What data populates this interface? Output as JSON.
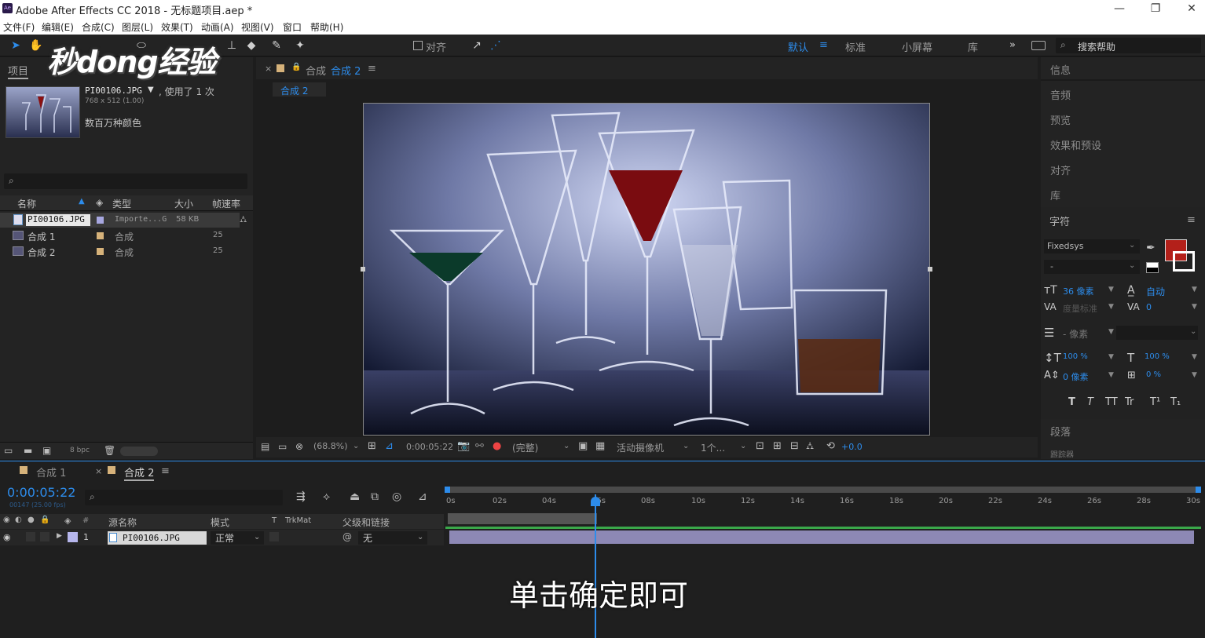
{
  "app": {
    "title": "Adobe After Effects CC 2018 - 无标题项目.aep *",
    "logo_text": "Ae"
  },
  "window_controls": {
    "minimize": "—",
    "maximize": "❐",
    "close": "✕"
  },
  "menu": [
    "文件(F)",
    "编辑(E)",
    "合成(C)",
    "图层(L)",
    "效果(T)",
    "动画(A)",
    "视图(V)",
    "窗口",
    "帮助(H)"
  ],
  "toolbar": {
    "align_label": "对齐",
    "workspaces": [
      "默认",
      "标准",
      "小屏幕",
      "库"
    ],
    "more": "»",
    "search_placeholder": "搜索帮助"
  },
  "watermark": "秒dong经验",
  "project": {
    "tab_label": "项目",
    "file_name": "PI00106.JPG",
    "usage": ", 使用了 1 次",
    "dimensions": "768 x 512 (1.00)",
    "colors": "数百万种颜色",
    "columns": [
      "名称",
      "类型",
      "大小",
      "帧速率"
    ],
    "rows": [
      {
        "name": "PI00106.JPG",
        "type": "Importe...G",
        "size": "58 KB",
        "fps": ""
      },
      {
        "name": "合成 1",
        "type": "合成",
        "size": "",
        "fps": "25"
      },
      {
        "name": "合成 2",
        "type": "合成",
        "size": "",
        "fps": "25"
      }
    ],
    "bpc": "8 bpc"
  },
  "comp": {
    "close": "×",
    "lock": "🔒",
    "title": "合成",
    "name": "合成 2",
    "tab": "合成 2"
  },
  "viewer_bar": {
    "zoom": "(68.8%)",
    "time": "0:00:05:22",
    "quality": "(完整)",
    "camera": "活动摄像机",
    "views": "1个...",
    "exposure": "+0.0"
  },
  "right_panel": {
    "items": [
      "信息",
      "音频",
      "预览",
      "效果和预设",
      "对齐",
      "库"
    ],
    "character": "字符",
    "font": "Fixedsys",
    "font_style": "-",
    "font_size": "36 像素",
    "leading": "自动",
    "kerning": "度量标准",
    "tracking": "0",
    "stroke": "- 像素",
    "vscale": "100 %",
    "hscale": "100 %",
    "baseline": "0 像素",
    "tsume": "0 %",
    "styles": [
      "T",
      "T",
      "TT",
      "Tr",
      "T¹",
      "T₁"
    ],
    "paragraph": "段落",
    "more": "跟踪器"
  },
  "timeline": {
    "tabs": [
      "合成 1",
      "合成 2"
    ],
    "timecode": "0:00:05:22",
    "fps_note": "00147 (25.00 fps)",
    "columns": [
      "源名称",
      "模式",
      "T",
      "TrkMat",
      "父级和链接"
    ],
    "layer": {
      "num": "1",
      "name": "PI00106.JPG",
      "mode": "正常",
      "parent": "无"
    },
    "ticks": [
      "0s",
      "02s",
      "04s",
      "06s",
      "08s",
      "10s",
      "12s",
      "14s",
      "16s",
      "18s",
      "20s",
      "22s",
      "24s",
      "26s",
      "28s",
      "30s"
    ]
  },
  "subtitle": "单击确定即可",
  "colors": {
    "accent": "#2d8ceb",
    "swatch": "#b3201a"
  }
}
